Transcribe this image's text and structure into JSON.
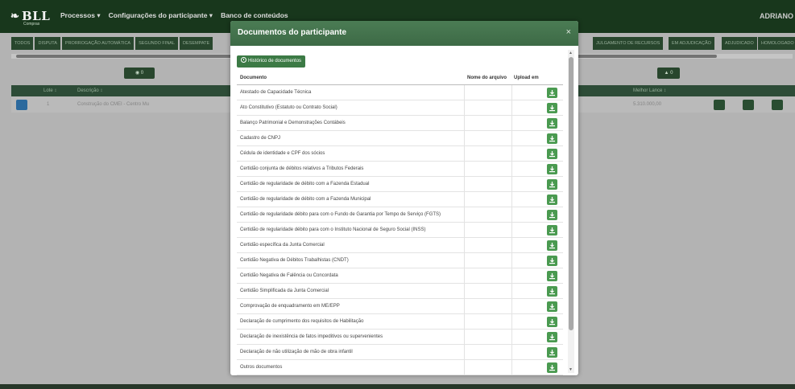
{
  "app": {
    "logo_mark": "❧",
    "logo_word": "BLL",
    "logo_sub": "Compras",
    "nav": [
      "Processos ▾",
      "Configurações do participante ▾",
      "Banco de conteúdos"
    ],
    "user": "ADRIANO"
  },
  "tabs": {
    "left": [
      "TODOS",
      "DISPUTA",
      "PRORROGAÇÃO AUTOMÁTICA",
      "SEGUNDO FINAL",
      "DESEMPATE"
    ],
    "right": [
      "JULGAMENTO DE RECURSOS",
      "EM ADJUDICAÇÃO",
      "ADJUDICADO",
      "HOMOLOGADO"
    ]
  },
  "filters": {
    "left_count": "0",
    "right_count": "0"
  },
  "table": {
    "headers": {
      "lote": "Lote ↕",
      "descricao": "Descrição ↕",
      "melhor_lance": "Melhor Lance ↕"
    },
    "row": {
      "lote": "1",
      "descricao": "Construção do CMEI - Centro Mu",
      "melhor_lance": "5.310.000,00"
    }
  },
  "modal": {
    "title": "Documentos do participante",
    "close": "×",
    "history_button": "Histórico de documentos",
    "columns": {
      "documento": "Documento",
      "nome_arquivo": "Nome do arquivo",
      "upload": "Upload em"
    },
    "documents": [
      "Atestado de Capacidade Técnica",
      "Ato Constitutivo (Estatuto ou Contrato Social)",
      "Balanço Patrimonial e Demonstrações Contábeis",
      "Cadastro de CNPJ",
      "Cédula de identidade e CPF dos sócios",
      "Certidão conjunta de débitos relativos a Tributos Federais",
      "Certidão de regularidade de débito com a Fazenda Estadual",
      "Certidão de regularidade de débito com a Fazenda Municipal",
      "Certidão de regularidade débito para com o Fundo de Garantia por Tempo de Serviço (FGTS)",
      "Certidão de regularidade débito para com o Instituto Nacional de Seguro Social (INSS)",
      "Certidão específica da Junta Comercial",
      "Certidão Negativa de Débitos Trabalhistas (CNDT)",
      "Certidão Negativa de Falência ou Concordata",
      "Certidão Simplificada da Junta Comercial",
      "Comprovação de enquadramento em ME/EPP",
      "Declaração de cumprimento dos requisitos de Habilitação",
      "Declaração de inexistência de fatos impeditivos ou supervenientes",
      "Declaração de não utilização de mão de obra infantil",
      "Outros documentos"
    ]
  },
  "colors": {
    "header_dark": "#1a3a1e",
    "modal_header": "#4b7c54",
    "accent_button": "#3c7a45",
    "download_button": "#4a9a50",
    "overlay": "#bdbdbd"
  },
  "icons": {
    "history": "clock-icon",
    "download": "download-icon",
    "close": "close-icon"
  }
}
